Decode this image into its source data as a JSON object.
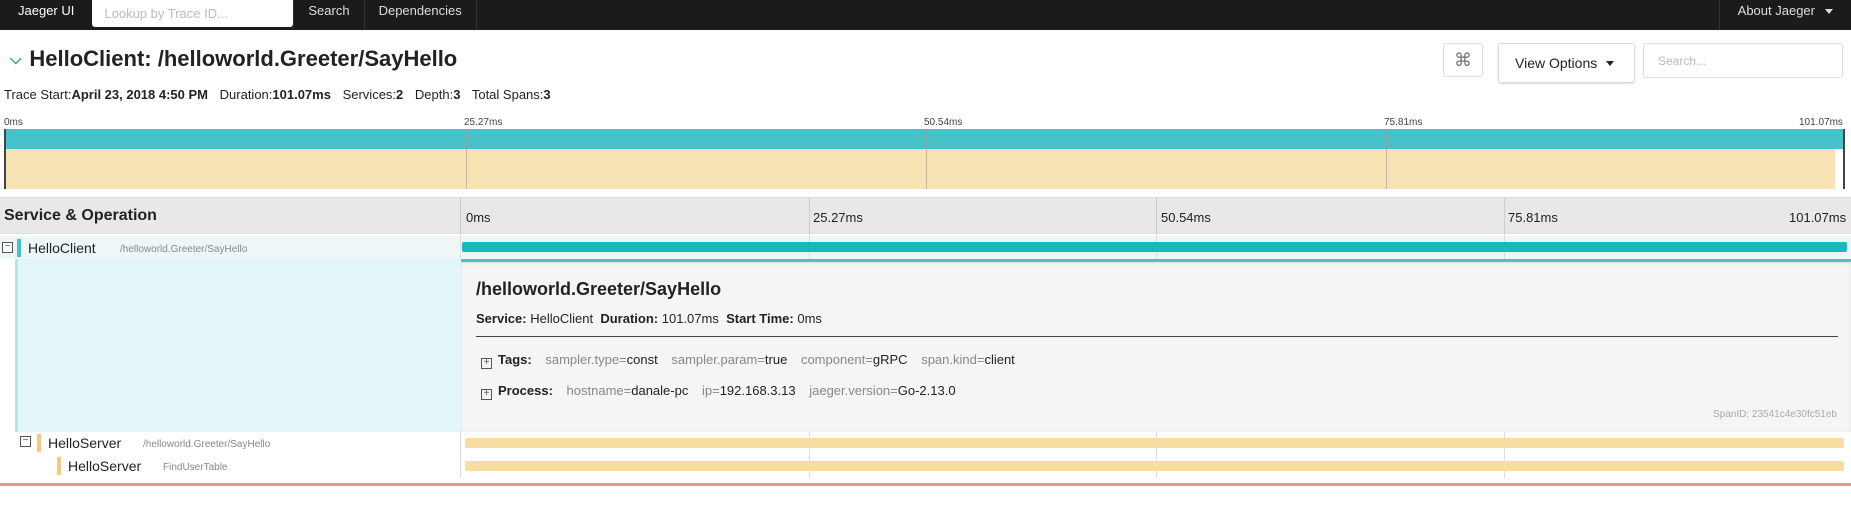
{
  "nav": {
    "brand": "Jaeger UI",
    "lookup_placeholder": "Lookup by Trace ID...",
    "links": [
      "Search",
      "Dependencies"
    ],
    "about": "About Jaeger"
  },
  "header": {
    "title": "HelloClient: /helloworld.Greeter/SayHello",
    "keyboard_icon": "⌘",
    "view_options": "View Options",
    "search_placeholder": "Search..."
  },
  "meta": {
    "trace_start_label": "Trace Start:",
    "trace_start": "April 23, 2018 4:50 PM",
    "duration_label": "Duration:",
    "duration": "101.07ms",
    "services_label": "Services:",
    "services": "2",
    "depth_label": "Depth:",
    "depth": "3",
    "total_spans_label": "Total Spans:",
    "total_spans": "3"
  },
  "ticks": [
    "0ms",
    "25.27ms",
    "50.54ms",
    "75.81ms",
    "101.07ms"
  ],
  "timeline": {
    "column_title": "Service & Operation"
  },
  "spans": [
    {
      "service": "HelloClient",
      "operation": "/helloworld.Greeter/SayHello",
      "color": "#17b8be",
      "start": 0,
      "duration": 1.0
    },
    {
      "service": "HelloServer",
      "operation": "/helloworld.Greeter/SayHello",
      "color": "#f8dca1",
      "start": 0.002,
      "duration": 0.996
    },
    {
      "service": "HelloServer",
      "operation": "FindUserTable",
      "color": "#f8dca1",
      "start": 0.002,
      "duration": 0.996
    }
  ],
  "detail": {
    "title": "/helloworld.Greeter/SayHello",
    "service_label": "Service:",
    "service": "HelloClient",
    "duration_label": "Duration:",
    "duration": "101.07ms",
    "start_label": "Start Time:",
    "start": "0ms",
    "tags_label": "Tags:",
    "tags": [
      {
        "key": "sampler.type",
        "value": "const"
      },
      {
        "key": "sampler.param",
        "value": "true"
      },
      {
        "key": "component",
        "value": "gRPC"
      },
      {
        "key": "span.kind",
        "value": "client"
      }
    ],
    "process_label": "Process:",
    "process": [
      {
        "key": "hostname",
        "value": "danale-pc"
      },
      {
        "key": "ip",
        "value": "192.168.3.13"
      },
      {
        "key": "jaeger.version",
        "value": "Go-2.13.0"
      }
    ],
    "span_id": "SpanID: 23541c4e30fc51eb"
  }
}
